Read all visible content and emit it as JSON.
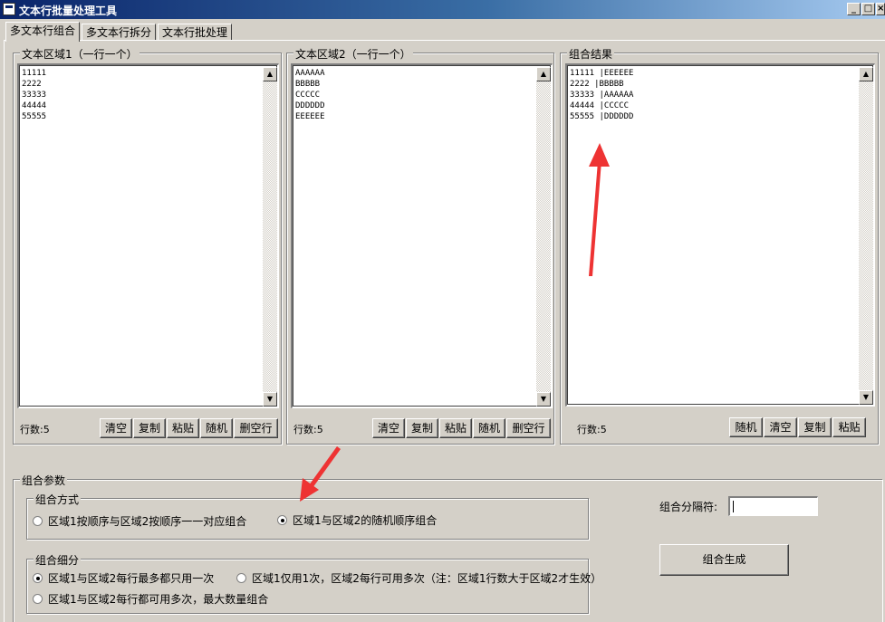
{
  "window": {
    "title": "文本行批量处理工具",
    "controls": [
      "_",
      "□",
      "×"
    ]
  },
  "tabs": [
    {
      "label": "多文本行组合",
      "active": true
    },
    {
      "label": "多文本行拆分",
      "active": false
    },
    {
      "label": "文本行批处理",
      "active": false
    }
  ],
  "area1": {
    "title": "文本区域1（一行一个）",
    "lines": [
      "11111",
      "2222",
      "33333",
      "44444",
      "55555"
    ],
    "count_label": "行数:5",
    "buttons": [
      "清空",
      "复制",
      "粘贴",
      "随机",
      "删空行"
    ]
  },
  "area2": {
    "title": "文本区域2（一行一个）",
    "lines": [
      "AAAAAA",
      "BBBBB",
      "CCCCC",
      "DDDDDD",
      "EEEEEE"
    ],
    "count_label": "行数:5",
    "buttons": [
      "清空",
      "复制",
      "粘贴",
      "随机",
      "删空行"
    ]
  },
  "result": {
    "title": "组合结果",
    "lines": [
      "11111 |EEEEEE",
      "2222 |BBBBB",
      "33333 |AAAAAA",
      "44444 |CCCCC",
      "55555 |DDDDDD"
    ],
    "count_label": "行数:5",
    "buttons": [
      "随机",
      "清空",
      "复制",
      "粘贴"
    ]
  },
  "params": {
    "title": "组合参数",
    "mode": {
      "title": "组合方式",
      "option1": "区域1按顺序与区域2按顺序一一对应组合",
      "option2": "区域1与区域2的随机顺序组合",
      "selected": 2
    },
    "detail": {
      "title": "组合细分",
      "option1": "区域1与区域2每行最多都只用一次",
      "option2": "区域1仅用1次，区域2每行可用多次（注：区域1行数大于区域2才生效）",
      "option3": "区域1与区域2每行都可用多次，最大数量组合",
      "selected": 1
    },
    "separator_label": "组合分隔符:",
    "separator_value": "",
    "generate_button": "组合生成"
  },
  "colors": {
    "annotation_arrow": "#ee3333",
    "title_bar_start": "#0a246a",
    "title_bar_end": "#a6caf0",
    "face": "#d4d0c8"
  }
}
